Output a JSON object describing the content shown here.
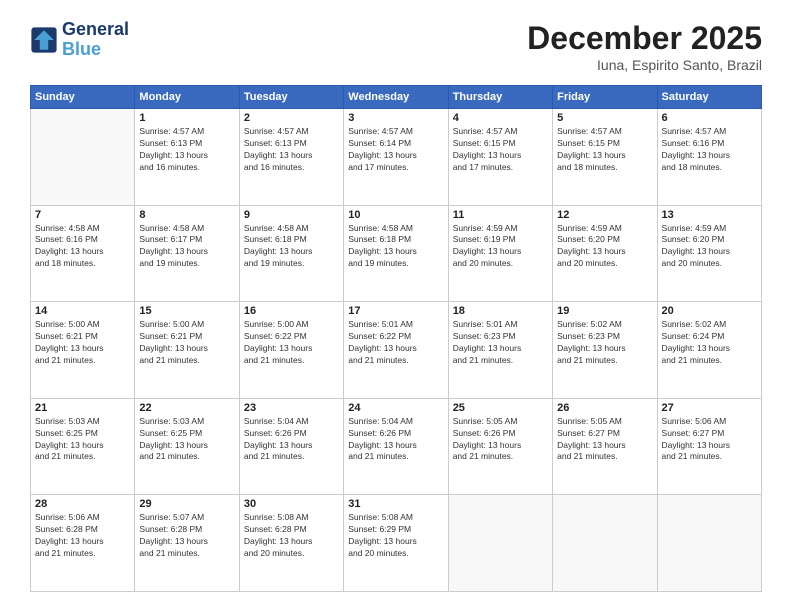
{
  "header": {
    "logo_line1": "General",
    "logo_line2": "Blue",
    "month": "December 2025",
    "location": "Iuna, Espirito Santo, Brazil"
  },
  "weekdays": [
    "Sunday",
    "Monday",
    "Tuesday",
    "Wednesday",
    "Thursday",
    "Friday",
    "Saturday"
  ],
  "weeks": [
    [
      {
        "day": "",
        "empty": true
      },
      {
        "day": "1",
        "sunrise": "4:57 AM",
        "sunset": "6:13 PM",
        "daylight": "13 hours and 16 minutes."
      },
      {
        "day": "2",
        "sunrise": "4:57 AM",
        "sunset": "6:13 PM",
        "daylight": "13 hours and 16 minutes."
      },
      {
        "day": "3",
        "sunrise": "4:57 AM",
        "sunset": "6:14 PM",
        "daylight": "13 hours and 17 minutes."
      },
      {
        "day": "4",
        "sunrise": "4:57 AM",
        "sunset": "6:15 PM",
        "daylight": "13 hours and 17 minutes."
      },
      {
        "day": "5",
        "sunrise": "4:57 AM",
        "sunset": "6:15 PM",
        "daylight": "13 hours and 18 minutes."
      },
      {
        "day": "6",
        "sunrise": "4:57 AM",
        "sunset": "6:16 PM",
        "daylight": "13 hours and 18 minutes."
      }
    ],
    [
      {
        "day": "7",
        "sunrise": "4:58 AM",
        "sunset": "6:16 PM",
        "daylight": "13 hours and 18 minutes."
      },
      {
        "day": "8",
        "sunrise": "4:58 AM",
        "sunset": "6:17 PM",
        "daylight": "13 hours and 19 minutes."
      },
      {
        "day": "9",
        "sunrise": "4:58 AM",
        "sunset": "6:18 PM",
        "daylight": "13 hours and 19 minutes."
      },
      {
        "day": "10",
        "sunrise": "4:58 AM",
        "sunset": "6:18 PM",
        "daylight": "13 hours and 19 minutes."
      },
      {
        "day": "11",
        "sunrise": "4:59 AM",
        "sunset": "6:19 PM",
        "daylight": "13 hours and 20 minutes."
      },
      {
        "day": "12",
        "sunrise": "4:59 AM",
        "sunset": "6:20 PM",
        "daylight": "13 hours and 20 minutes."
      },
      {
        "day": "13",
        "sunrise": "4:59 AM",
        "sunset": "6:20 PM",
        "daylight": "13 hours and 20 minutes."
      }
    ],
    [
      {
        "day": "14",
        "sunrise": "5:00 AM",
        "sunset": "6:21 PM",
        "daylight": "13 hours and 21 minutes."
      },
      {
        "day": "15",
        "sunrise": "5:00 AM",
        "sunset": "6:21 PM",
        "daylight": "13 hours and 21 minutes."
      },
      {
        "day": "16",
        "sunrise": "5:00 AM",
        "sunset": "6:22 PM",
        "daylight": "13 hours and 21 minutes."
      },
      {
        "day": "17",
        "sunrise": "5:01 AM",
        "sunset": "6:22 PM",
        "daylight": "13 hours and 21 minutes."
      },
      {
        "day": "18",
        "sunrise": "5:01 AM",
        "sunset": "6:23 PM",
        "daylight": "13 hours and 21 minutes."
      },
      {
        "day": "19",
        "sunrise": "5:02 AM",
        "sunset": "6:23 PM",
        "daylight": "13 hours and 21 minutes."
      },
      {
        "day": "20",
        "sunrise": "5:02 AM",
        "sunset": "6:24 PM",
        "daylight": "13 hours and 21 minutes."
      }
    ],
    [
      {
        "day": "21",
        "sunrise": "5:03 AM",
        "sunset": "6:25 PM",
        "daylight": "13 hours and 21 minutes."
      },
      {
        "day": "22",
        "sunrise": "5:03 AM",
        "sunset": "6:25 PM",
        "daylight": "13 hours and 21 minutes."
      },
      {
        "day": "23",
        "sunrise": "5:04 AM",
        "sunset": "6:26 PM",
        "daylight": "13 hours and 21 minutes."
      },
      {
        "day": "24",
        "sunrise": "5:04 AM",
        "sunset": "6:26 PM",
        "daylight": "13 hours and 21 minutes."
      },
      {
        "day": "25",
        "sunrise": "5:05 AM",
        "sunset": "6:26 PM",
        "daylight": "13 hours and 21 minutes."
      },
      {
        "day": "26",
        "sunrise": "5:05 AM",
        "sunset": "6:27 PM",
        "daylight": "13 hours and 21 minutes."
      },
      {
        "day": "27",
        "sunrise": "5:06 AM",
        "sunset": "6:27 PM",
        "daylight": "13 hours and 21 minutes."
      }
    ],
    [
      {
        "day": "28",
        "sunrise": "5:06 AM",
        "sunset": "6:28 PM",
        "daylight": "13 hours and 21 minutes."
      },
      {
        "day": "29",
        "sunrise": "5:07 AM",
        "sunset": "6:28 PM",
        "daylight": "13 hours and 21 minutes."
      },
      {
        "day": "30",
        "sunrise": "5:08 AM",
        "sunset": "6:28 PM",
        "daylight": "13 hours and 20 minutes."
      },
      {
        "day": "31",
        "sunrise": "5:08 AM",
        "sunset": "6:29 PM",
        "daylight": "13 hours and 20 minutes."
      },
      {
        "day": "",
        "empty": true
      },
      {
        "day": "",
        "empty": true
      },
      {
        "day": "",
        "empty": true
      }
    ]
  ]
}
